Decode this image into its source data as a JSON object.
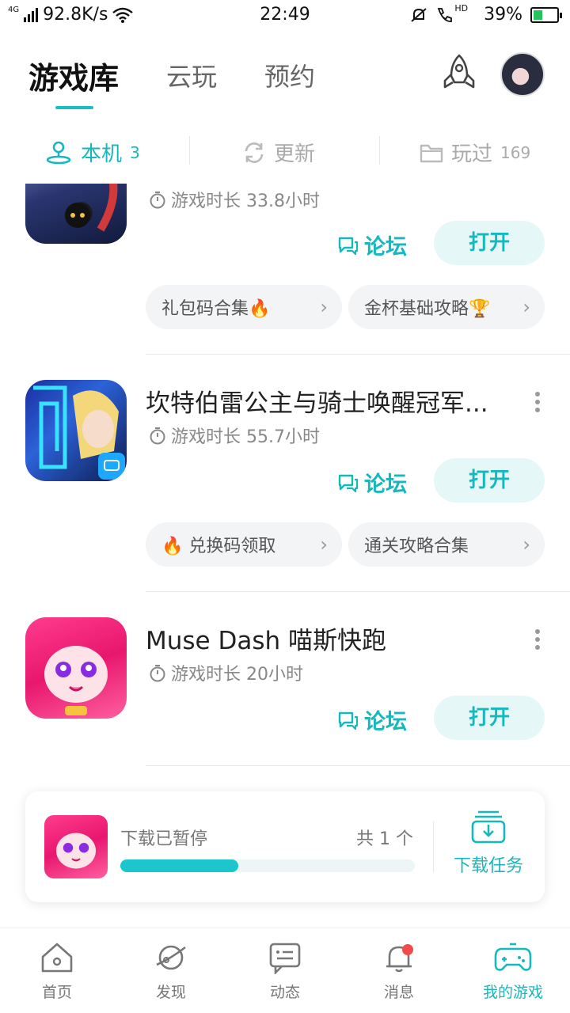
{
  "status_bar": {
    "network": "4G",
    "speed": "92.8K/s",
    "time": "22:49",
    "hd": "HD",
    "battery": "39%",
    "battery_level": 0.39
  },
  "header": {
    "tabs": [
      {
        "label": "游戏库"
      },
      {
        "label": "云玩"
      },
      {
        "label": "预约"
      }
    ],
    "active_tab": "游戏库",
    "icons": [
      "rocket-icon",
      "avatar"
    ]
  },
  "subtabs": [
    {
      "label": "本机",
      "count": "3",
      "icon": "user-location-icon"
    },
    {
      "label": "更新",
      "count": "",
      "icon": "refresh-icon"
    },
    {
      "label": "玩过",
      "count": "169",
      "icon": "folder-icon"
    }
  ],
  "games": [
    {
      "name": "",
      "playtime": "游戏时长 33.8小时",
      "forum": "论坛",
      "open": "打开",
      "chips": [
        "礼包码合集🔥",
        "金杯基础攻略🏆"
      ]
    },
    {
      "name": "坎特伯雷公主与骑士唤醒冠军...",
      "playtime": "游戏时长 55.7小时",
      "forum": "论坛",
      "open": "打开",
      "chips": [
        "🔥 兑换码领取",
        "通关攻略合集"
      ]
    },
    {
      "name": "Muse Dash 喵斯快跑",
      "playtime": "游戏时长 20小时",
      "forum": "论坛",
      "open": "打开",
      "chips": []
    }
  ],
  "download": {
    "status": "下载已暂停",
    "count": "共 1 个",
    "progress": 0.4,
    "task_label": "下载任务"
  },
  "bottom_nav": [
    {
      "label": "首页",
      "icon": "home-icon"
    },
    {
      "label": "发现",
      "icon": "planet-icon"
    },
    {
      "label": "动态",
      "icon": "message-icon"
    },
    {
      "label": "消息",
      "icon": "bell-icon"
    },
    {
      "label": "我的游戏",
      "icon": "gamepad-icon"
    }
  ],
  "colors": {
    "accent": "#17b8bd",
    "badge": "#f2494a"
  }
}
